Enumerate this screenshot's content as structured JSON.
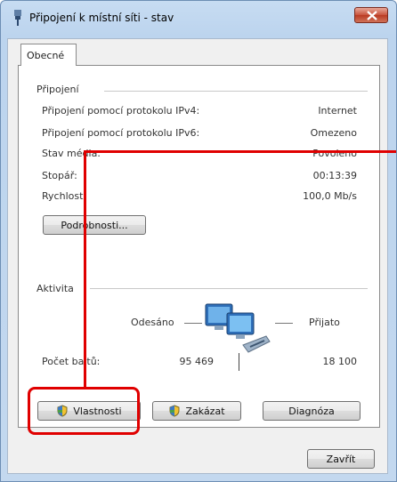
{
  "window": {
    "title": "Připojení k místní síti - stav"
  },
  "tabs": [
    {
      "label": "Obecné"
    }
  ],
  "connection": {
    "group_label": "Připojení",
    "rows": [
      {
        "label": "Připojení pomocí protokolu IPv4:",
        "value": "Internet"
      },
      {
        "label": "Připojení pomocí protokolu IPv6:",
        "value": "Omezeno"
      },
      {
        "label": "Stav média:",
        "value": "Povoleno"
      },
      {
        "label": "Stopář:",
        "value": "00:13:39"
      },
      {
        "label": "Rychlost:",
        "value": "100,0 Mb/s"
      }
    ],
    "details_button": "Podrobnosti..."
  },
  "activity": {
    "group_label": "Aktivita",
    "sent_label": "Odesáno",
    "received_label": "Přijato",
    "bytes_label": "Počet bajtů:",
    "bytes_sent": "95 469",
    "bytes_received": "18 100"
  },
  "buttons": {
    "properties": "Vlastnosti",
    "disable": "Zakázat",
    "diagnose": "Diagnóza",
    "close": "Zavřít"
  },
  "icons": {
    "title": "network-plug-icon",
    "close": "close-icon",
    "network": "network-computers-icon",
    "shield": "uac-shield-icon"
  },
  "colors": {
    "highlight": "#e00000",
    "titlebar": "#bcd4ee",
    "close_button": "#c8513b"
  }
}
